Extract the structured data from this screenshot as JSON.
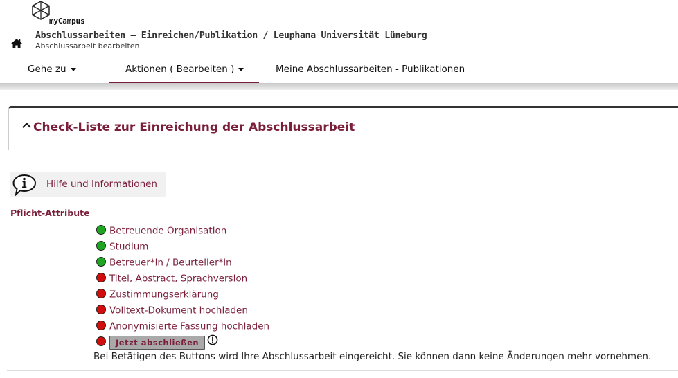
{
  "app": {
    "logo_text": "myCampus"
  },
  "header": {
    "title": "Abschlussarbeiten – Einreichen/Publikation  / Leuphana Universität Lüneburg",
    "subtitle": "Abschlussarbeit bearbeiten"
  },
  "nav": [
    {
      "label": "Gehe zu",
      "dropdown": true,
      "active": false
    },
    {
      "label": "Aktionen ( Bearbeiten )",
      "dropdown": true,
      "active": true
    },
    {
      "label": "Meine Abschlussarbeiten - Publikationen",
      "dropdown": false,
      "active": false
    }
  ],
  "panel": {
    "title": "Check-Liste zur Einreichung der Abschlussarbeit",
    "expanded": true
  },
  "help": {
    "label": "Hilfe und Informationen",
    "icon": "info-speech-bubble-icon"
  },
  "section": {
    "label": "Pflicht-Attribute"
  },
  "checklist": [
    {
      "label": "Betreuende Organisation",
      "status": "complete"
    },
    {
      "label": "Studium",
      "status": "complete"
    },
    {
      "label": "Betreuer*in / Beurteiler*in",
      "status": "complete"
    },
    {
      "label": "Titel, Abstract, Sprachversion",
      "status": "incomplete"
    },
    {
      "label": "Zustimmungserklärung",
      "status": "incomplete"
    },
    {
      "label": "Volltext-Dokument hochladen",
      "status": "incomplete"
    },
    {
      "label": "Anonymisierte Fassung hochladen",
      "status": "incomplete"
    }
  ],
  "submit": {
    "status": "incomplete",
    "button_label": "Jetzt abschließen",
    "note": "Bei Betätigen des Buttons wird Ihre Abschlussarbeit eingereicht. Sie können dann keine Änderungen mehr vornehmen."
  },
  "colors": {
    "accent": "#7a1e3a",
    "complete": "#1fa521",
    "incomplete": "#d10e0e",
    "button_bg": "#a9a9a9"
  }
}
